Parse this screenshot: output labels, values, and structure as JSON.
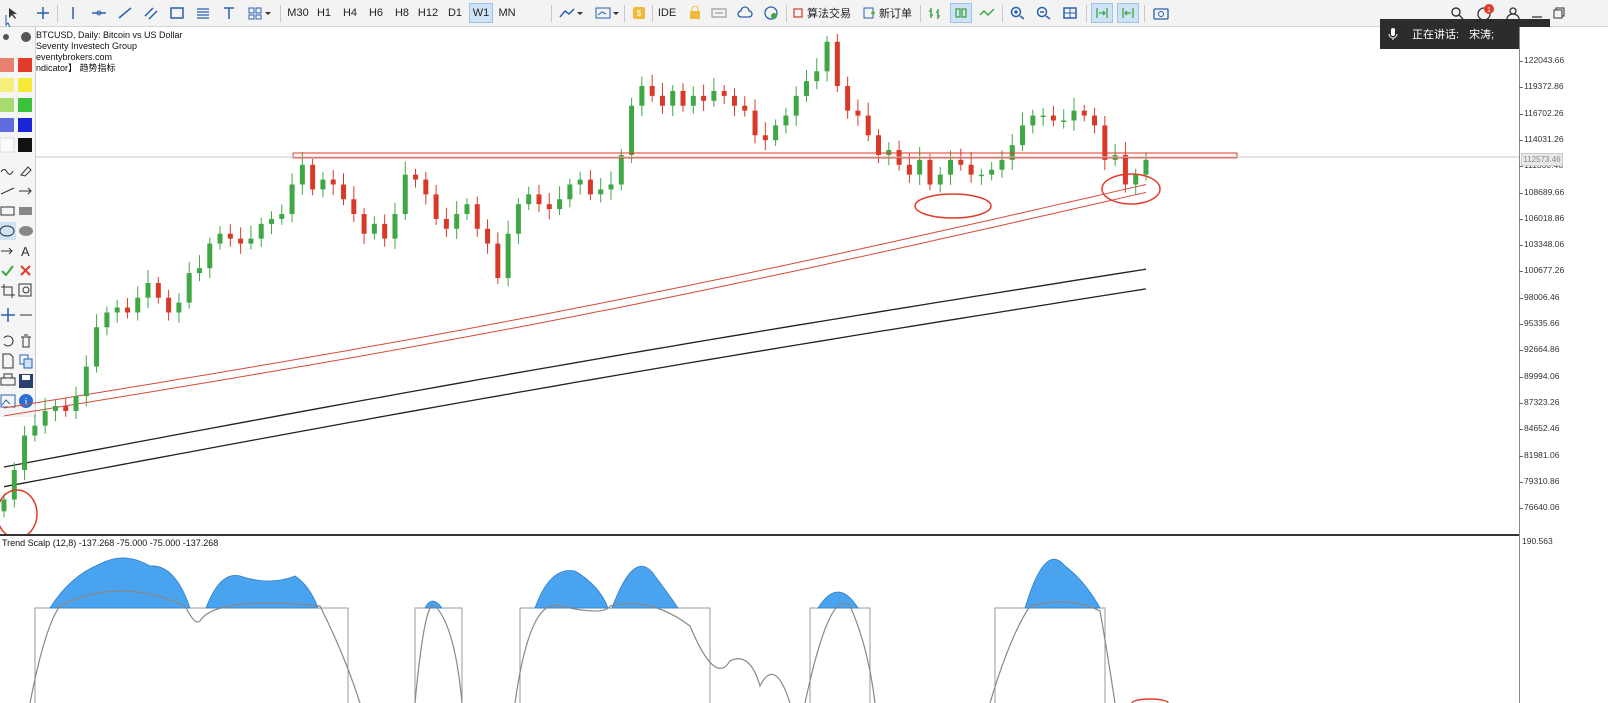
{
  "toolbar": {
    "timeframes": [
      "M30",
      "H1",
      "H4",
      "H6",
      "H8",
      "H12",
      "D1",
      "W1",
      "MN"
    ],
    "active_timeframe": "D1",
    "ide_label": "IDE",
    "algo_label": "算法交易",
    "new_order_label": "新订单",
    "notification_count": "1"
  },
  "speaking": {
    "label": "正在讲话:",
    "speaker": "宋涛;"
  },
  "chart": {
    "symbol_line": "BTCUSD, Daily:  Bitcoin vs US Dollar",
    "broker_line": "Seventy Investech Group",
    "site_line": "eventybrokers.com",
    "indicator_line": "ndicator】 趋势指标",
    "current_price_tag": "112573.46",
    "price_scale": [
      "122043.66",
      "119372.86",
      "116702.26",
      "114031.26",
      "111360.46",
      "108689.66",
      "106018.86",
      "103348.06",
      "100677.26",
      "98006.46",
      "95335.66",
      "92664.86",
      "89994.06",
      "87323.26",
      "84652.46",
      "81981.06",
      "79310.86",
      "76640.06"
    ],
    "indicator_label": "Trend Scalp (12,8) -137.268 -75.000 -75.000 -137.268",
    "indicator_max": "190.563"
  },
  "chart_data": {
    "type": "line",
    "title": "BTCUSD, Daily:  Bitcoin vs US Dollar",
    "ylim": [
      75000,
      126000
    ],
    "ohlc_closes_approx": [
      77500,
      80500,
      84000,
      85000,
      86500,
      87000,
      86500,
      88000,
      91000,
      95000,
      96500,
      97000,
      96500,
      98000,
      99500,
      98000,
      96500,
      97500,
      100500,
      101000,
      103500,
      104500,
      104000,
      103500,
      104000,
      105500,
      106000,
      106500,
      109500,
      111500,
      109000,
      110000,
      109500,
      108000,
      106500,
      104500,
      105500,
      104000,
      106500,
      110500,
      110000,
      108500,
      106000,
      105000,
      106500,
      107500,
      105000,
      103500,
      100000,
      104500,
      107500,
      108500,
      107500,
      107000,
      108000,
      109500,
      110000,
      108500,
      109000,
      109500,
      112500,
      117500,
      119500,
      118500,
      117500,
      119000,
      117500,
      118500,
      118000,
      119000,
      118500,
      117500,
      117000,
      114500,
      114000,
      115500,
      116500,
      118500,
      120000,
      121000,
      124000,
      119500,
      117000,
      116500,
      114500,
      112500,
      113000,
      111500,
      110500,
      112000,
      109500,
      110500,
      112000,
      111500,
      110500,
      110500,
      111000,
      112000,
      113500,
      115500,
      116500,
      116500,
      116000,
      116000,
      117000,
      116500,
      115500,
      112000,
      112500,
      109500,
      110500,
      112000
    ],
    "series": [
      {
        "name": "",
        "color": "#d84a3c",
        "values_start": 86800,
        "values_end": 109500
      },
      {
        "name": "",
        "color": "#d84a3c",
        "values_start": 86000,
        "values_end": 108700
      },
      {
        "name": "",
        "color": "#222222",
        "values_start": 80800,
        "values_end": 100900
      },
      {
        "name": "",
        "color": "#222222",
        "values_start": 78800,
        "values_end": 98900
      }
    ],
    "horizontal_zone": [
      112200,
      112700
    ],
    "annotations": [
      "circle-low-left",
      "circle-mid-right",
      "circle-current"
    ],
    "indicator": {
      "name": "Trend Scalp (12,8)",
      "values": [
        -137.268,
        -75.0,
        -75.0,
        -137.268
      ],
      "max": 190.563
    }
  },
  "colors": {
    "bull": "#3fa845",
    "bear": "#d83a2a",
    "ema_red": "#d84a3c",
    "ema_black": "#222222",
    "indicator_fill": "#4aa3ee",
    "notif_bg": "#2c2c2c"
  }
}
